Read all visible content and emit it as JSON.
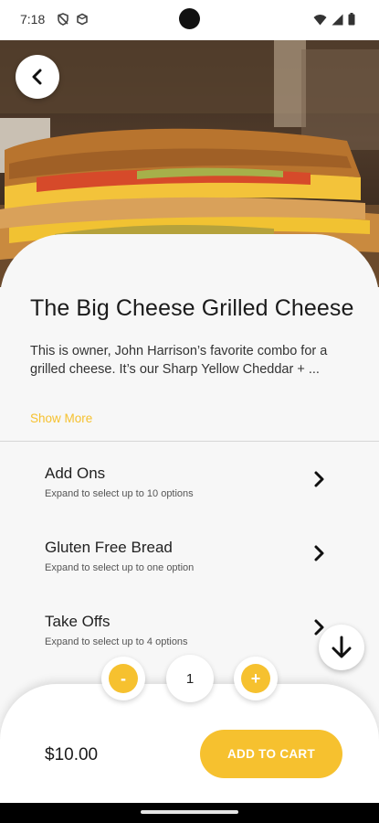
{
  "status_bar": {
    "time": "7:18",
    "left_icons": [
      "shield-off-icon",
      "cube-icon"
    ],
    "right_icons": [
      "wifi-icon",
      "cell-signal-icon",
      "battery-icon"
    ]
  },
  "hero": {
    "image": "grilled-cheese-sandwich-photo"
  },
  "product": {
    "title": "The Big Cheese Grilled Cheese",
    "description": "This is owner, John Harrison’s favorite combo for a grilled cheese. It’s our Sharp Yellow Cheddar + ...",
    "show_more_label": "Show More"
  },
  "options": [
    {
      "name": "Add Ons",
      "hint": "Expand to select up to 10 options"
    },
    {
      "name": "Gluten Free Bread",
      "hint": "Expand to select up to one option"
    },
    {
      "name": "Take Offs",
      "hint": "Expand to select up to 4 options"
    }
  ],
  "quantity": {
    "decrement_label": "-",
    "value": "1",
    "increment_label": "+"
  },
  "cart": {
    "price": "$10.00",
    "add_to_cart_label": "ADD TO CART"
  },
  "colors": {
    "accent": "#f6c12f",
    "background": "#f7f7f7",
    "text": "#1b1b1b"
  }
}
